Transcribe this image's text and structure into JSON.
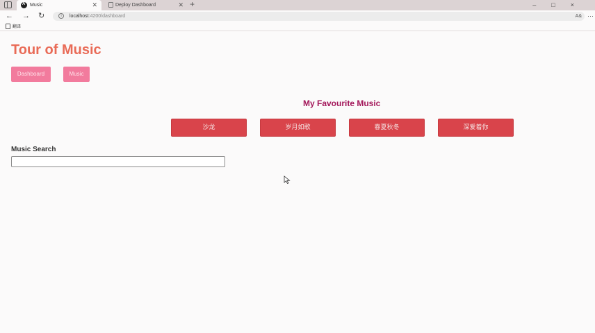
{
  "browser": {
    "tabs": [
      {
        "title": "Music",
        "active": true
      },
      {
        "title": "Deploy Dashboard",
        "active": false
      }
    ],
    "new_tab": "+",
    "window_controls": "–□×",
    "address": {
      "host": "localhost",
      "path": ":4200/dashboard"
    },
    "read_aloud": "A&",
    "bookmark_label": "翻译"
  },
  "app": {
    "title": "Tour of Music",
    "nav": {
      "dashboard": "Dashboard",
      "music": "Music"
    }
  },
  "dashboard": {
    "heading": "My Favourite Music",
    "favourites": [
      "沙龙",
      "岁月如歌",
      "春夏秋冬",
      "深爱着你"
    ]
  },
  "search": {
    "label": "Music Search",
    "value": "",
    "placeholder": ""
  },
  "colors": {
    "title": "#e96b57",
    "nav_button": "#f27b9d",
    "heading": "#a3175a",
    "fav_button": "#d9444b"
  }
}
